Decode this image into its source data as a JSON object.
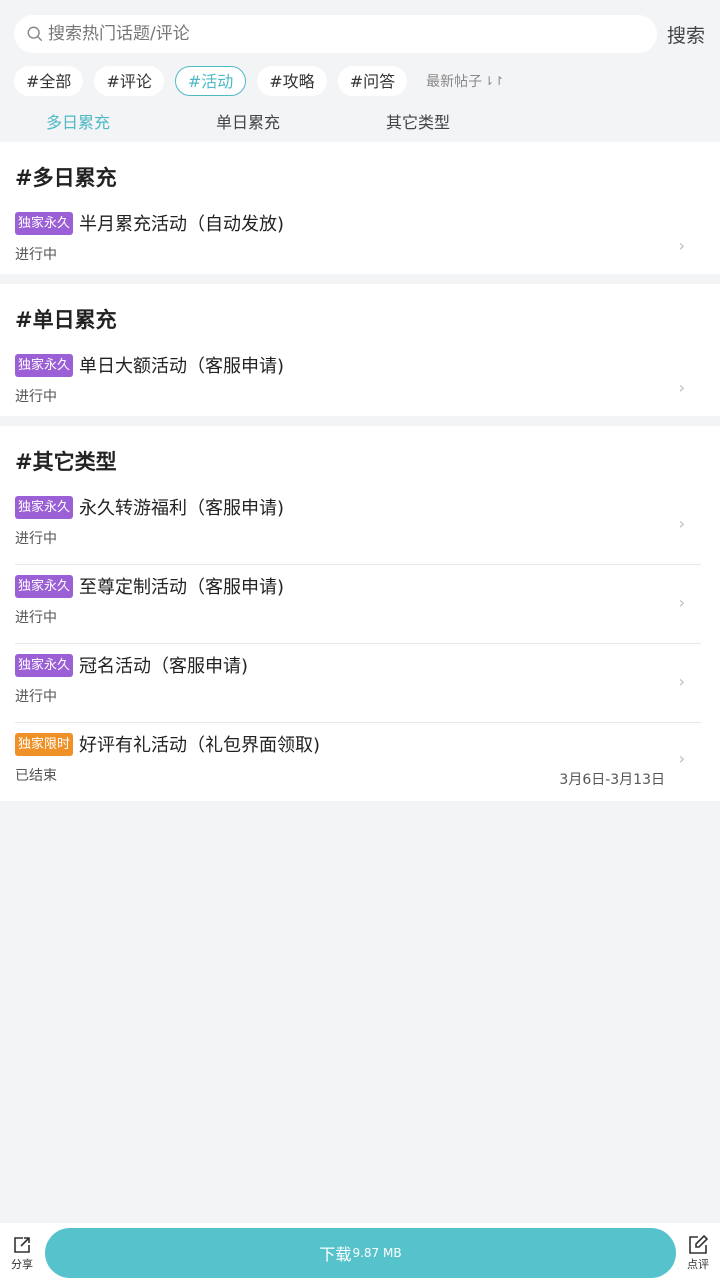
{
  "search": {
    "placeholder": "搜索热门话题/评论",
    "button": "搜索"
  },
  "tags": [
    "#全部",
    "#评论",
    "#活动",
    "#攻略",
    "#问答"
  ],
  "active_tag": "#活动",
  "sort": {
    "label": "最新帖子",
    "icon": "sort-icon"
  },
  "tabs": [
    "多日累充",
    "单日累充",
    "其它类型"
  ],
  "active_tab": "多日累充",
  "sections": [
    {
      "title": "#多日累充",
      "items": [
        {
          "badge": "独家永久",
          "badge_color": "#9b5fd6",
          "title": "半月累充活动（自动发放)",
          "status": "进行中"
        }
      ]
    },
    {
      "title": "#单日累充",
      "items": [
        {
          "badge": "独家永久",
          "badge_color": "#9b5fd6",
          "title": "单日大额活动（客服申请)",
          "status": "进行中"
        }
      ]
    },
    {
      "title": "#其它类型",
      "items": [
        {
          "badge": "独家永久",
          "badge_color": "#9b5fd6",
          "title": "永久转游福利（客服申请)",
          "status": "进行中"
        },
        {
          "badge": "独家永久",
          "badge_color": "#9b5fd6",
          "title": "至尊定制活动（客服申请)",
          "status": "进行中"
        },
        {
          "badge": "独家永久",
          "badge_color": "#9b5fd6",
          "title": "冠名活动（客服申请)",
          "status": "进行中"
        },
        {
          "badge": "独家限时",
          "badge_color": "#ef9126",
          "title": "好评有礼活动（礼包界面领取)",
          "status": "已结束",
          "date": "3月6日-3月13日"
        }
      ]
    }
  ],
  "bottom": {
    "share": "分享",
    "download": "下载",
    "size": "9.87 MB",
    "review": "点评"
  },
  "colors": {
    "accent": "#4fb9c6",
    "download_bg": "#56c2cc",
    "badge_permanent": "#9b5fd6",
    "badge_limited": "#ef9126"
  }
}
